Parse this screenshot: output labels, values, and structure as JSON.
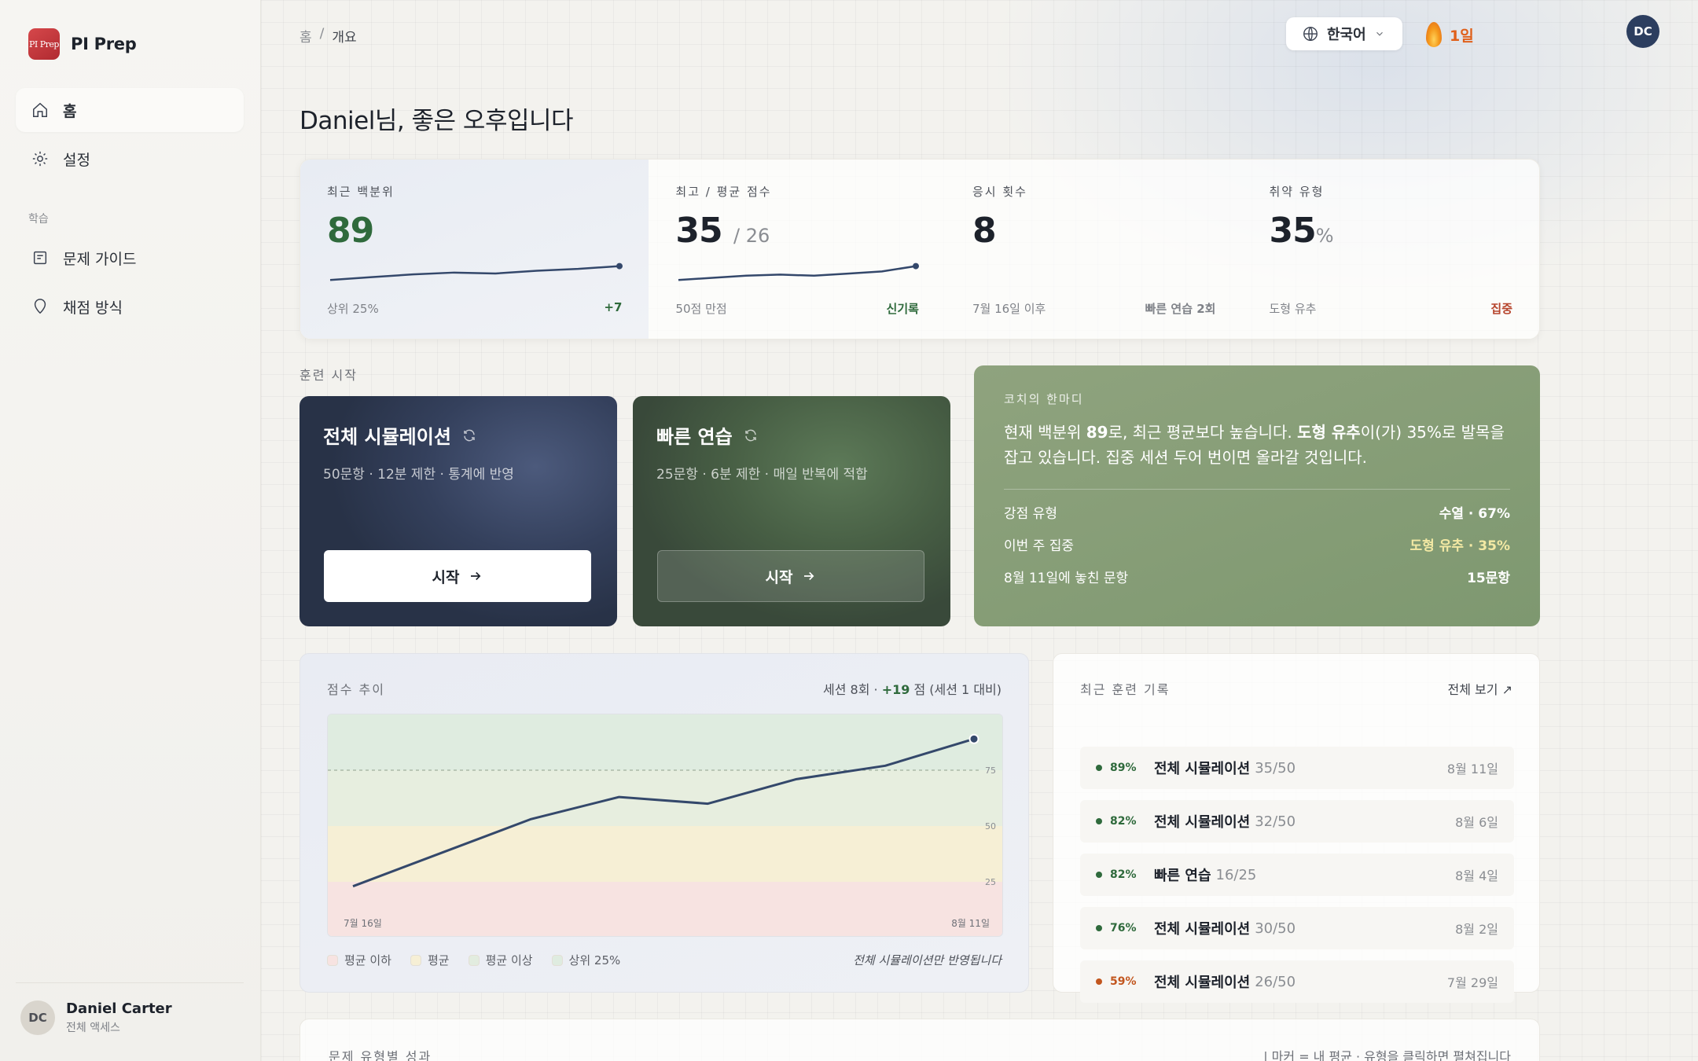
{
  "brand": {
    "logo_text": "PI Prep",
    "name": "PI Prep"
  },
  "sidebar": {
    "items": [
      {
        "label": "홈",
        "icon": "home-icon"
      },
      {
        "label": "설정",
        "icon": "gear-icon"
      }
    ],
    "section_label": "학습",
    "learn_items": [
      {
        "label": "문제 가이드",
        "icon": "document-icon"
      },
      {
        "label": "채점 방식",
        "icon": "pin-icon"
      }
    ],
    "user": {
      "initials": "DC",
      "name": "Daniel Carter",
      "sub": "전체 액세스"
    }
  },
  "header": {
    "breadcrumb": [
      "홈",
      "/",
      "개요"
    ],
    "language": "한국어",
    "streak": "1일",
    "avatar": "DC"
  },
  "greeting": "Daniel님, 좋은 오후입니다",
  "stats": [
    {
      "label": "최근 백분위",
      "value": "89",
      "suffix": "",
      "foot_left": "상위 25%",
      "foot_right": "+7",
      "foot_style": "green"
    },
    {
      "label": "최고 / 평균 점수",
      "value": "35",
      "suffix": "/ 26",
      "foot_left": "50점 만점",
      "foot_right": "신기록",
      "foot_style": "green"
    },
    {
      "label": "응시 횟수",
      "value": "8",
      "suffix": "",
      "foot_left": "7월 16일 이후",
      "foot_right": "빠른 연습 2회",
      "foot_style": "gray"
    },
    {
      "label": "취약 유형",
      "value": "35",
      "suffix": "%",
      "foot_left": "도형 유추",
      "foot_right": "집중",
      "foot_style": "red"
    }
  ],
  "training": {
    "section_label": "훈련 시작",
    "cards": [
      {
        "title": "전체 시뮬레이션",
        "sub": "50문항 · 12분 제한 · 통계에 반영",
        "button": "시작"
      },
      {
        "title": "빠른 연습",
        "sub": "25문항 · 6분 제한 · 매일 반복에 적합",
        "button": "시작"
      }
    ]
  },
  "coach": {
    "label": "코치의 한마디",
    "msg_1": "현재 백분위 ",
    "msg_b1": "89",
    "msg_2": "로, 최근 평균보다 높습니다. ",
    "msg_b2": "도형 유추",
    "msg_3": "이(가) 35%로 발목을 잡고 있습니다. 집중 세션 두어 번이면 올라갈 것입니다.",
    "rows": [
      {
        "k": "강점 유형",
        "v": "수열 · 67%"
      },
      {
        "k": "이번 주 집중",
        "v": "도형 유추 · 35%"
      },
      {
        "k": "8월 11일에 놓친 문항",
        "v": "15문항"
      }
    ]
  },
  "trend": {
    "label": "점수 추이",
    "summary_a": "세션 8회 · ",
    "summary_b": "+19",
    "summary_c": " 점 (세션 1 대비)",
    "legend": [
      "평균 이하",
      "평균",
      "평균 이상",
      "상위 25%"
    ],
    "legend_colors": [
      "#f7e3e1",
      "#f6efd5",
      "#e2ecdf",
      "#dfece0"
    ],
    "note": "전체 시뮬레이션만 반영됩니다"
  },
  "chart_data": {
    "type": "line",
    "x": [
      "7월 16일",
      "",
      "",
      "",
      "",
      "",
      "",
      "8월 11일"
    ],
    "x_tick_labels": [
      "7월 16일",
      "8월 11일"
    ],
    "y_tick_labels": [
      "75",
      "50",
      "25"
    ],
    "series": [
      {
        "values": [
          23,
          38,
          53,
          63,
          60,
          71,
          77,
          89
        ]
      }
    ],
    "bands": [
      {
        "from": 0,
        "to": 25,
        "color": "#f7e3e1"
      },
      {
        "from": 25,
        "to": 50,
        "color": "#f6efd5"
      },
      {
        "from": 50,
        "to": 75,
        "color": "#e7eedf"
      },
      {
        "from": 75,
        "to": 100,
        "color": "#dfece0"
      }
    ],
    "reference_line": 75,
    "ylim": [
      0,
      100
    ]
  },
  "sparklines": [
    [
      74,
      77,
      80,
      82,
      81,
      84,
      86,
      89
    ],
    [
      22,
      24,
      26,
      27,
      26,
      28,
      30,
      35
    ],
    [],
    []
  ],
  "recent": {
    "label": "최근 훈련 기록",
    "view_all": "전체 보기 ↗",
    "rows": [
      {
        "pct": "89%",
        "name": "전체 시뮬레이션",
        "score": "35/50",
        "date": "8월 11일",
        "color": "#2f6a3c"
      },
      {
        "pct": "82%",
        "name": "전체 시뮬레이션",
        "score": "32/50",
        "date": "8월 6일",
        "color": "#2f6a3c"
      },
      {
        "pct": "82%",
        "name": "빠른 연습",
        "score": "16/25",
        "date": "8월 4일",
        "color": "#2f6a3c"
      },
      {
        "pct": "76%",
        "name": "전체 시뮬레이션",
        "score": "30/50",
        "date": "8월 2일",
        "color": "#2f6a3c"
      },
      {
        "pct": "59%",
        "name": "전체 시뮬레이션",
        "score": "26/50",
        "date": "7월 29일",
        "color": "#c2561e"
      }
    ]
  },
  "bottom": {
    "label": "문제 유형별 성과",
    "note": "| 마커 = 내 평균 · 유형을 클릭하면 펼쳐집니다"
  }
}
